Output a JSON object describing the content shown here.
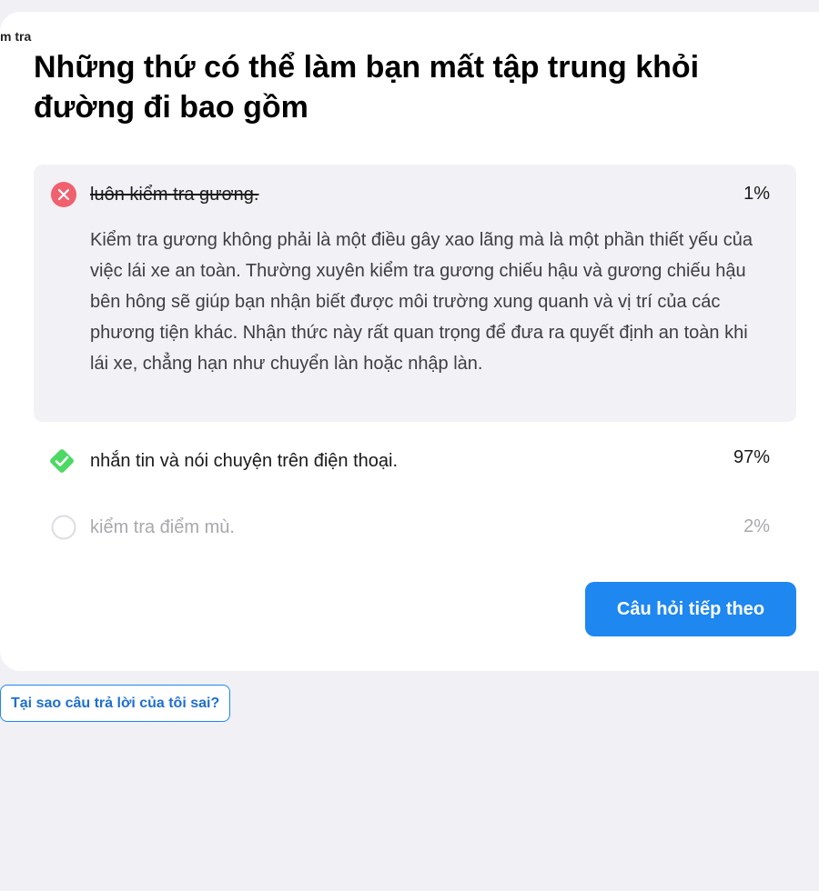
{
  "breadcrumb": "m tra",
  "question": "Những thứ có thể làm bạn mất tập trung khỏi đường đi bao gồm",
  "answers": [
    {
      "text": "luôn kiểm tra gương.",
      "percent": "1%",
      "status": "incorrect-selected",
      "icon": "x-circle-icon",
      "explanation": "Kiểm tra gương không phải là một điều gây xao lãng mà là một phần thiết yếu của việc lái xe an toàn. Thường xuyên kiểm tra gương chiếu hậu và gương chiếu hậu bên hông sẽ giúp bạn nhận biết được môi trường xung quanh và vị trí của các phương tiện khác. Nhận thức này rất quan trọng để đưa ra quyết định an toàn khi lái xe, chẳng hạn như chuyển làn hoặc nhập làn."
    },
    {
      "text": "nhắn tin và nói chuyện trên điện thoại.",
      "percent": "97%",
      "status": "correct",
      "icon": "check-diamond-icon"
    },
    {
      "text": "kiểm tra điểm mù.",
      "percent": "2%",
      "status": "unselected",
      "icon": "empty-circle-icon"
    }
  ],
  "buttons": {
    "next": "Câu hỏi tiếp theo",
    "why_wrong": "Tại sao câu trả lời của tôi sai?"
  },
  "colors": {
    "background": "#f0f0f5",
    "card": "#ffffff",
    "selected_answer_bg": "#f1f1f6",
    "incorrect": "#f0606e",
    "correct": "#4cd964",
    "primary": "#1e87f0",
    "muted_text": "#a8a8ad"
  }
}
